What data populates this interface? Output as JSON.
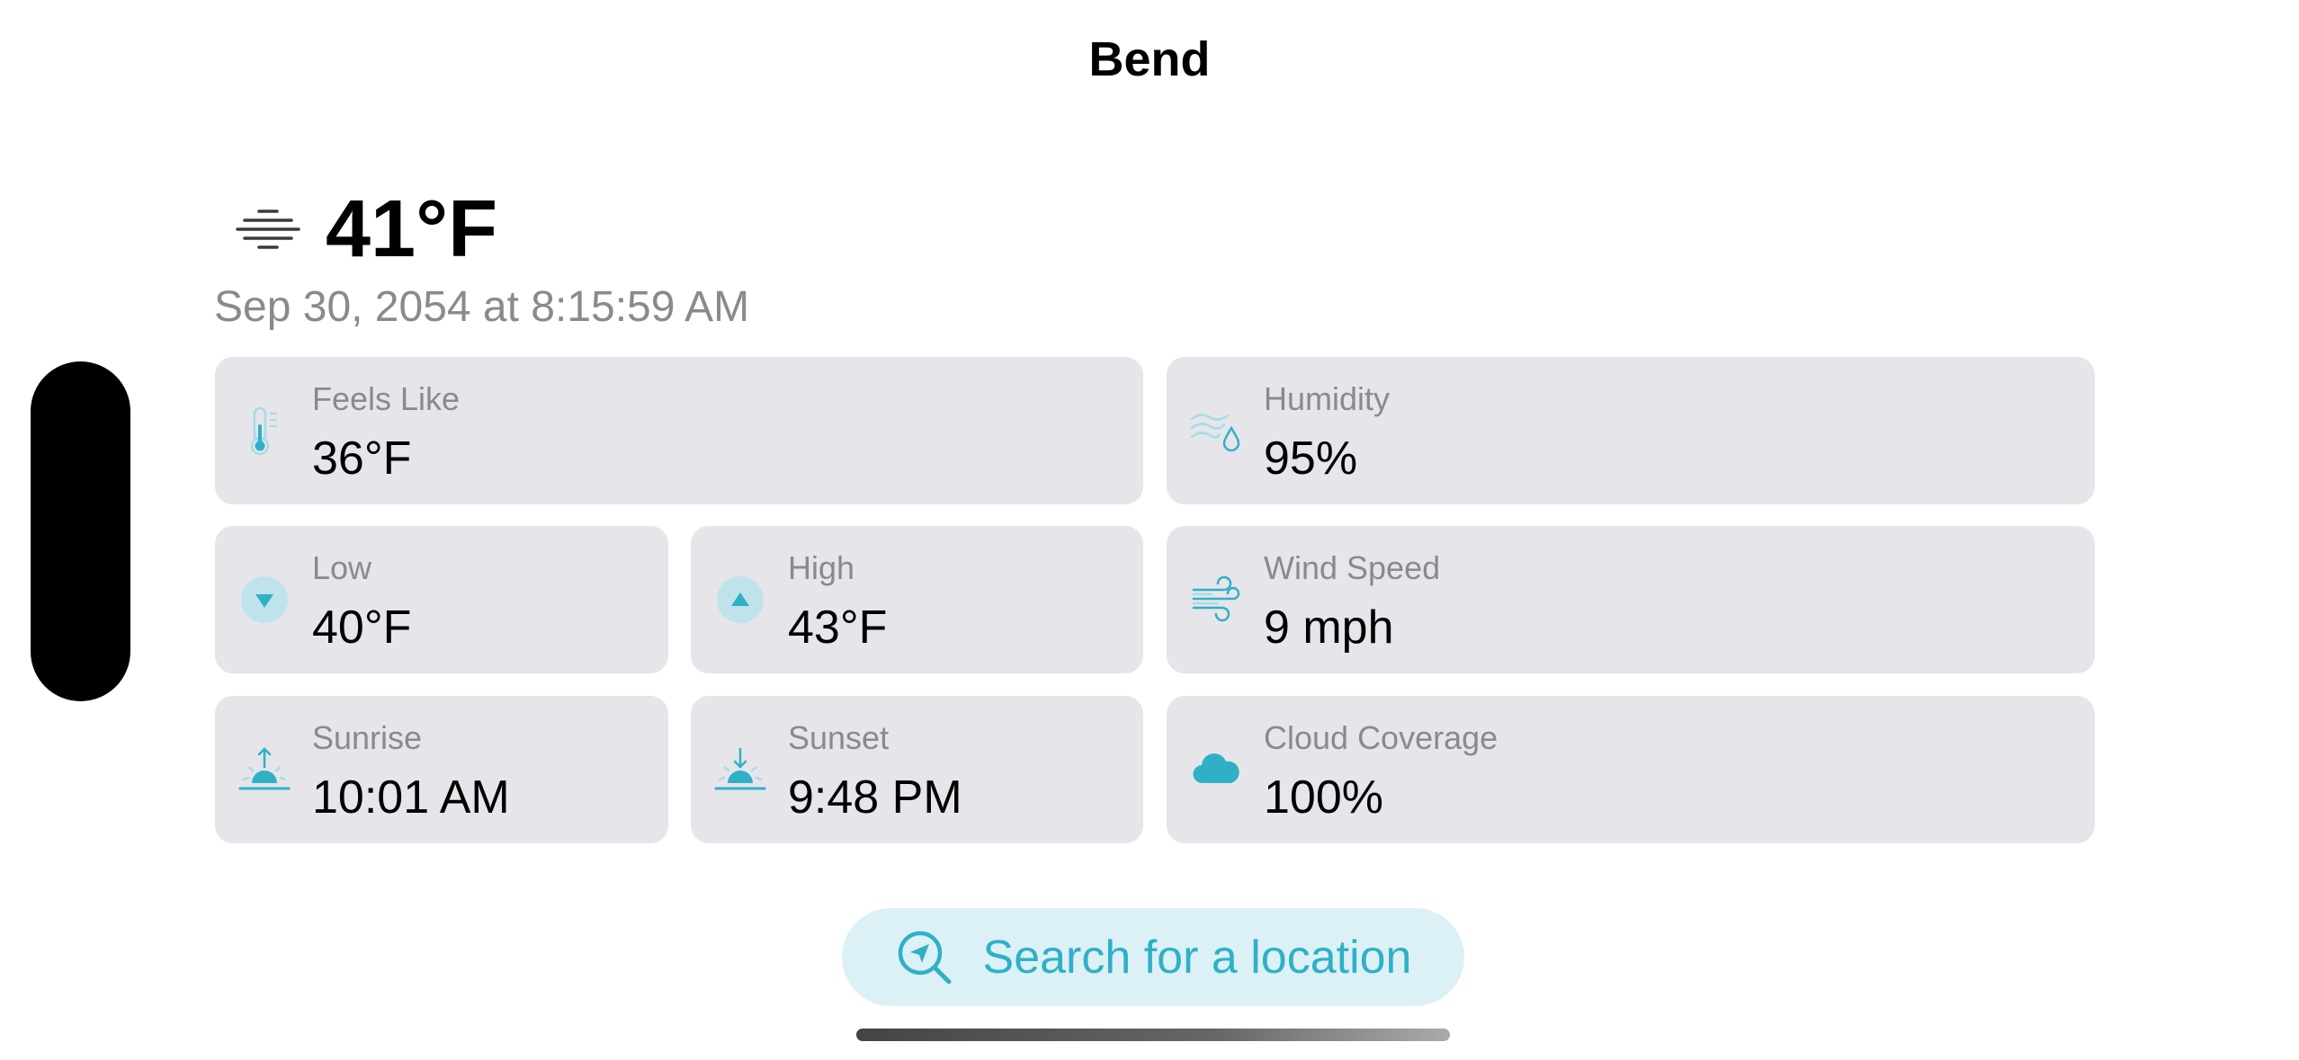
{
  "header": {
    "title": "Bend"
  },
  "current": {
    "temperature": "41°F",
    "condition_icon": "fog-icon",
    "timestamp": "Sep 30, 2054 at 8:15:59 AM"
  },
  "metrics": {
    "feels_like": {
      "label": "Feels Like",
      "value": "36°F",
      "icon": "thermometer-icon"
    },
    "humidity": {
      "label": "Humidity",
      "value": "95%",
      "icon": "humidity-icon"
    },
    "low": {
      "label": "Low",
      "value": "40°F",
      "icon": "arrow-down-circle-icon"
    },
    "high": {
      "label": "High",
      "value": "43°F",
      "icon": "arrow-up-circle-icon"
    },
    "wind_speed": {
      "label": "Wind Speed",
      "value": "9 mph",
      "icon": "wind-icon"
    },
    "sunrise": {
      "label": "Sunrise",
      "value": "10:01 AM",
      "icon": "sunrise-icon"
    },
    "sunset": {
      "label": "Sunset",
      "value": "9:48 PM",
      "icon": "sunset-icon"
    },
    "cloud_coverage": {
      "label": "Cloud Coverage",
      "value": "100%",
      "icon": "cloud-icon"
    }
  },
  "search": {
    "label": "Search for a location",
    "icon": "location-search-icon"
  },
  "colors": {
    "accent": "#30b0c7",
    "card_background": "#e5e5ea",
    "secondary_text": "#8a8a8e",
    "search_background": "#dbf1f5"
  }
}
